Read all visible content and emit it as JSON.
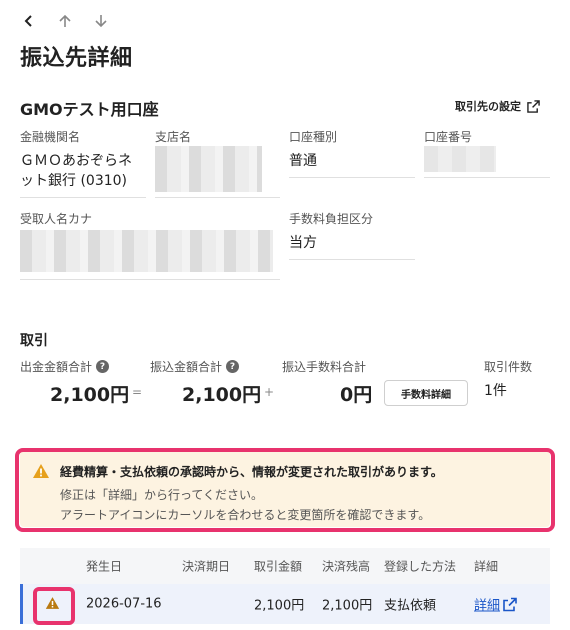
{
  "page": {
    "title": "振込先詳細"
  },
  "nav": {
    "back_icon": "chevron-left-icon",
    "up_icon": "arrow-up-icon",
    "down_icon": "arrow-down-icon"
  },
  "account": {
    "title": "GMOテスト用口座",
    "settings_label": "取引先の設定",
    "fields": {
      "bank_label": "金融機関名",
      "bank_value_1": "ＧＭＯあおぞらネ",
      "bank_value_2": "ット銀行 (0310)",
      "branch_label": "支店名",
      "account_type_label": "口座種別",
      "account_type_value": "普通",
      "account_number_label": "口座番号",
      "recipient_kana_label": "受取人名カナ",
      "fee_bearer_label": "手数料負担区分",
      "fee_bearer_value": "当方"
    }
  },
  "transactions": {
    "section_title": "取引",
    "totals": {
      "withdrawal_label": "出金金額合計",
      "transfer_label": "振込金額合計",
      "fee_label": "振込手数料合計",
      "count_label": "取引件数",
      "withdrawal_value": "2,100円",
      "eq": "=",
      "transfer_value": "2,100円",
      "plus": "+",
      "fee_value": "0円",
      "fee_detail_button": "手数料詳細",
      "count_value": "1件"
    },
    "alert": {
      "line1": "経費精算・支払依頼の承認時から、情報が変更された取引があります。",
      "line2": "修正は「詳細」から行ってください。",
      "line3": "アラートアイコンにカーソルを合わせると変更箇所を確認できます。"
    },
    "table": {
      "headers": [
        "発生日",
        "決済期日",
        "取引金額",
        "決済残高",
        "登録した方法",
        "詳細"
      ],
      "rows": [
        {
          "date": "2026-07-16",
          "due": "",
          "amount": "2,100円",
          "balance": "2,100円",
          "method": "支払依頼",
          "detail": "詳細"
        }
      ]
    }
  },
  "colors": {
    "accent": "#1a56c8",
    "warning": "#e6a01c",
    "highlight": "#e8336d",
    "alert_bg": "#fdf3e1"
  }
}
